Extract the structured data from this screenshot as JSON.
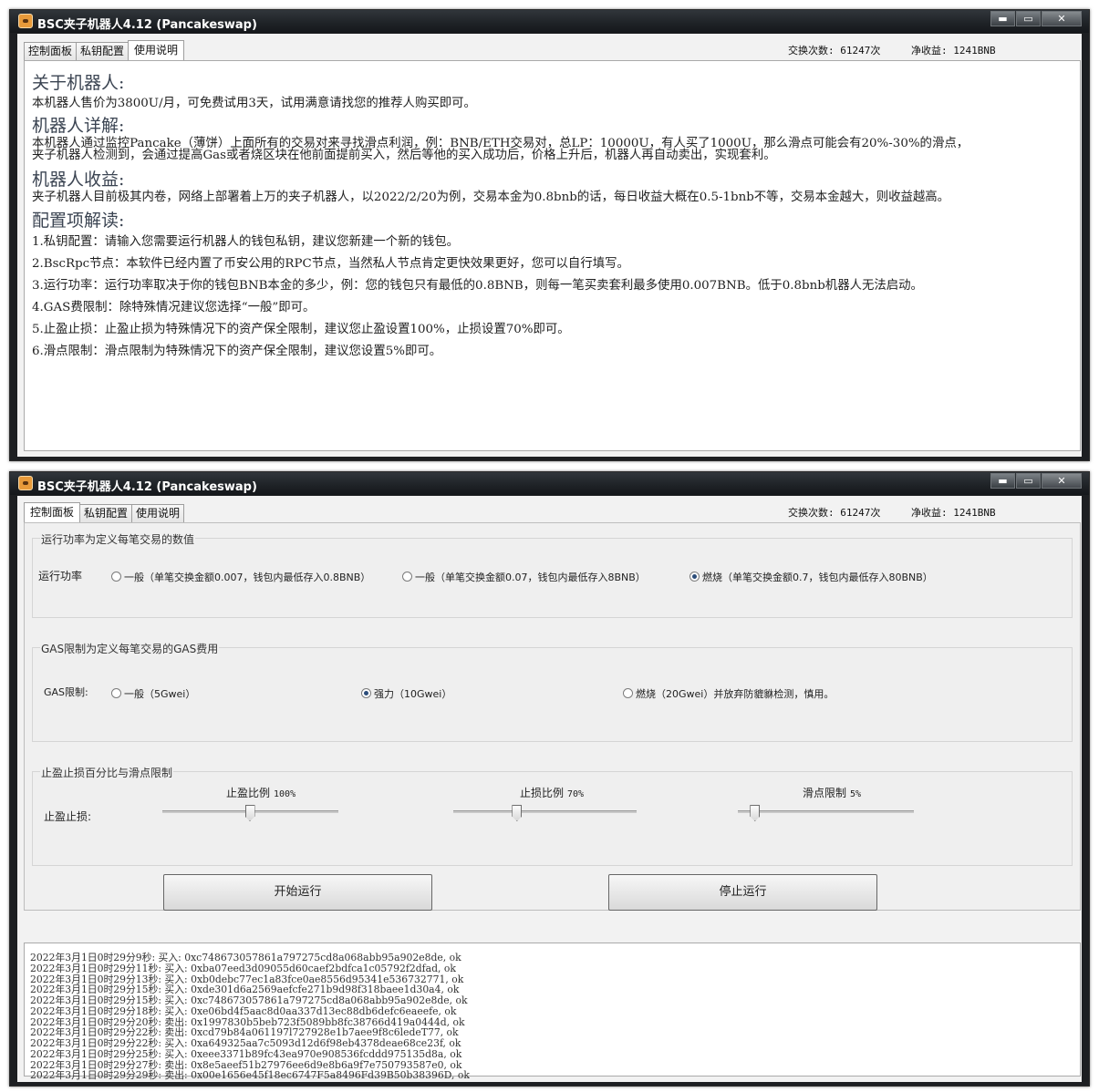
{
  "app": {
    "title": "BSC夹子机器人4.12 (Pancakeswap)",
    "window_buttons": {
      "minimize": "▬",
      "maximize": "▭",
      "close": "✕"
    }
  },
  "tabs": [
    "控制面板",
    "私钥配置",
    "使用说明"
  ],
  "stats": {
    "swaps": "交换次数: 61247次",
    "profit": "净收益: 1241BNB"
  },
  "help": {
    "h1": "关于机器人:",
    "p1": "本机器人售价为3800U/月，可免费试用3天，试用满意请找您的推荐人购买即可。",
    "h2": "机器人详解:",
    "p2": "本机器人通过监控Pancake（薄饼）上面所有的交易对来寻找滑点利润，例：BNB/ETH交易对，总LP：10000U，有人买了1000U，那么滑点可能会有20%-30%的滑点，夹子机器人检测到，会通过提高Gas或者烧区块在他前面提前买入，然后等他的买入成功后，价格上升后，机器人再自动卖出，实现套利。",
    "h3": "机器人收益:",
    "p3": "夹子机器人目前极其内卷，网络上部署着上万的夹子机器人，以2022/2/20为例，交易本金为0.8bnb的话，每日收益大概在0.5-1bnb不等，交易本金越大，则收益越高。",
    "h4": "配置项解读:",
    "items": [
      "1.私钥配置：请输入您需要运行机器人的钱包私钥，建议您新建一个新的钱包。",
      "2.BscRpc节点：本软件已经内置了币安公用的RPC节点，当然私人节点肯定更快效果更好，您可以自行填写。",
      "3.运行功率：运行功率取决于你的钱包BNB本金的多少，例：您的钱包只有最低的0.8BNB，则每一笔买卖套利最多使用0.007BNB。低于0.8bnb机器人无法启动。",
      "4.GAS费限制：除特殊情况建议您选择“一般”即可。",
      "5.止盈止损：止盈止损为特殊情况下的资产保全限制，建议您止盈设置100%，止损设置70%即可。",
      "6.滑点限制：滑点限制为特殊情况下的资产保全限制，建议您设置5%即可。"
    ]
  },
  "control": {
    "group1": {
      "legend": "运行功率为定义每笔交易的数值",
      "label": "运行功率",
      "options": [
        "一般（单笔交换金额0.007，钱包内最低存入0.8BNB）",
        "一般（单笔交换金额0.07，钱包内最低存入8BNB）",
        "燃烧（单笔交换金额0.7，钱包内最低存入80BNB）"
      ],
      "selected_index": 2
    },
    "group2": {
      "legend": "GAS限制为定义每笔交易的GAS费用",
      "label": "GAS限制:",
      "options": [
        "一般（5Gwei）",
        "强力（10Gwei）",
        "燃烧（20Gwei）并放弃防貔貅检测，慎用。"
      ],
      "selected_index": 1
    },
    "group3": {
      "legend": "止盈止损百分比与滑点限制",
      "label": "止盈止损:",
      "sliders": [
        {
          "label": "止盈比例",
          "value_text": "100%",
          "level": 0.5
        },
        {
          "label": "止损比例",
          "value_text": "70%",
          "level": 0.35
        },
        {
          "label": "滑点限制",
          "value_text": "5%",
          "level": 0.1
        }
      ]
    },
    "start_label": "开始运行",
    "stop_label": "停止运行"
  },
  "log": [
    "2022年3月1日0时29分9秒:  买入: 0xc748673057861a797275cd8a068abb95a902e8de, ok",
    "2022年3月1日0时29分11秒:  买入: 0xba07eed3d09055d60caef2bdfca1c05792f2dfad, ok",
    "2022年3月1日0时29分13秒:  买入: 0xb0debc77ec1a83fce0ae8556d95341e536732771, ok",
    "2022年3月1日0时29分15秒:  买入: 0xde301d6a2569aefcfe271b9d98f318baee1d30a4, ok",
    "2022年3月1日0时29分15秒:  买入: 0xc748673057861a797275cd8a068abb95a902e8de, ok",
    "2022年3月1日0时29分18秒:  买入: 0xe06bd4f5aac8d0aa337d13ec88db6defc6eaeefe, ok",
    "2022年3月1日0时29分20秒:  卖出: 0x1997830b5beb723f5089bb8fc38766d419a0444d, ok",
    "2022年3月1日0时29分22秒:  卖出: 0xcd79b84a061197l727928e1b7aee9f8c6ledeT77, ok",
    "2022年3月1日0时29分22秒:  买入: 0xa649325aa7c5093d12d6f98eb4378deae68ce23f, ok",
    "2022年3月1日0时29分25秒:  买入: 0xeee3371b89fc43ea970e908536fcddd975135d8a, ok",
    "2022年3月1日0时29分27秒:  卖出: 0x8e5aeef51b27976ee6d9e8b6a9f7e750793587e0, ok",
    "2022年3月1日0时29分29秒:  卖出: 0x00e1656e45f18ec6747F5a8496Fd39B50b38396D, ok"
  ]
}
